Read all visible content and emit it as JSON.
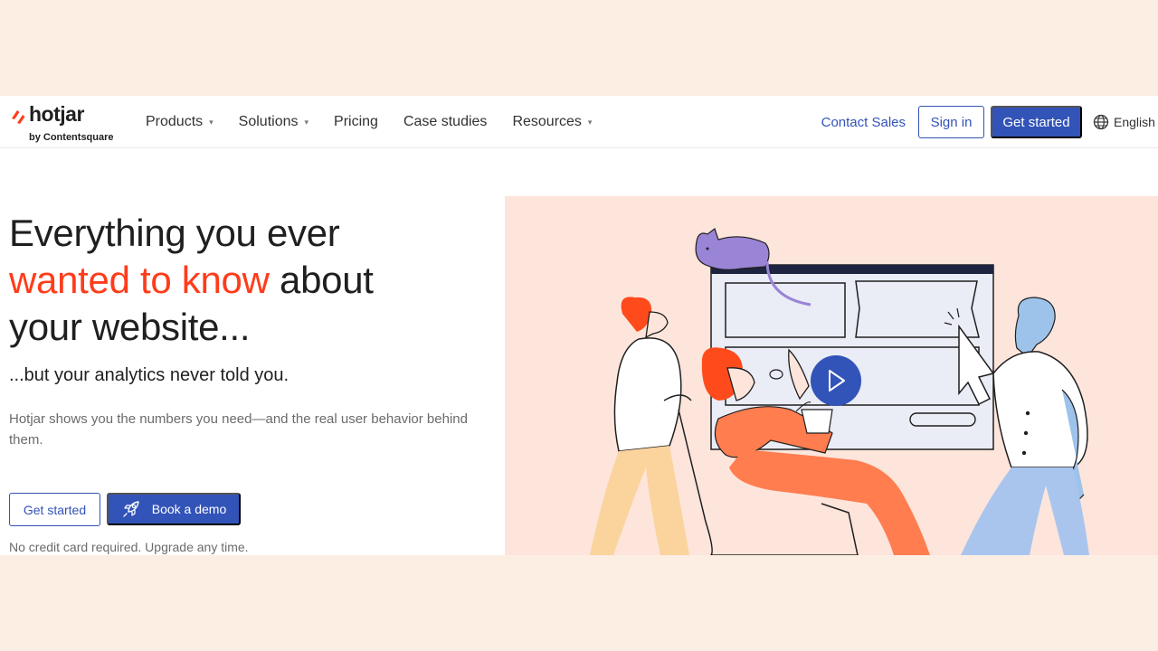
{
  "brand": {
    "name": "hotjar",
    "byline": "by Contentsquare",
    "accent_color": "#ff3c1a",
    "primary_color": "#3253b8"
  },
  "nav": {
    "items": [
      {
        "label": "Products",
        "has_dropdown": true
      },
      {
        "label": "Solutions",
        "has_dropdown": true
      },
      {
        "label": "Pricing",
        "has_dropdown": false
      },
      {
        "label": "Case studies",
        "has_dropdown": false
      },
      {
        "label": "Resources",
        "has_dropdown": true
      }
    ],
    "contact_sales": "Contact Sales",
    "sign_in": "Sign in",
    "get_started": "Get started",
    "language": "English",
    "language_icon": "globe-icon"
  },
  "hero": {
    "title_line1": "Everything you ever",
    "title_accent": "wanted to know",
    "title_after_accent": " about",
    "title_line3": "your website...",
    "subtitle": "...but your analytics never told you.",
    "body": "Hotjar shows you the numbers you need—and the real user behavior behind them.",
    "cta_primary": "Get started",
    "cta_demo": "Book a demo",
    "cta_demo_icon": "rocket-icon",
    "note": "No credit card required. Upgrade any time.",
    "play_icon": "play-icon"
  }
}
